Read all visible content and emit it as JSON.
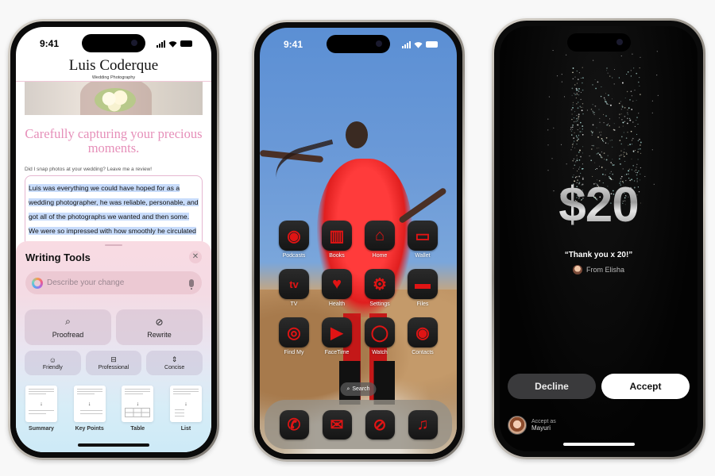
{
  "status_bar": {
    "time": "9:41"
  },
  "writing_phone": {
    "site_title": "Luis Coderque",
    "site_subtitle": "Wedding Photography",
    "tagline": "Carefully capturing your precious moments.",
    "review_prompt": "Did I snap photos at your wedding? Leave me a review!",
    "review_text": "Luis was everything we could have hoped for as a wedding photographer, he was reliable, personable, and got all of the photographs we wanted and then some. We were so impressed with how smoothly he circulated through our ceremony and reception. We barely realized he was there except when he was very",
    "writing_tools": {
      "title": "Writing Tools",
      "close_icon": "xmark",
      "input_placeholder": "Describe your change",
      "primary_actions": [
        {
          "label": "Proofread",
          "icon": "magnifier-text-icon"
        },
        {
          "label": "Rewrite",
          "icon": "rewrite-icon"
        }
      ],
      "tone_actions": [
        {
          "label": "Friendly",
          "icon": "smiley-icon"
        },
        {
          "label": "Professional",
          "icon": "briefcase-icon"
        },
        {
          "label": "Concise",
          "icon": "compress-icon"
        }
      ],
      "formats": [
        {
          "label": "Summary"
        },
        {
          "label": "Key Points"
        },
        {
          "label": "Table"
        },
        {
          "label": "List"
        }
      ]
    }
  },
  "home_phone": {
    "apps": [
      {
        "label": "Podcasts",
        "glyph": "◉"
      },
      {
        "label": "Books",
        "glyph": "▥"
      },
      {
        "label": "Home",
        "glyph": "⌂"
      },
      {
        "label": "Wallet",
        "glyph": "▭"
      },
      {
        "label": "TV",
        "glyph": "tv"
      },
      {
        "label": "Health",
        "glyph": "♥"
      },
      {
        "label": "Settings",
        "glyph": "⚙"
      },
      {
        "label": "Files",
        "glyph": "▬"
      },
      {
        "label": "Find My",
        "glyph": "◎"
      },
      {
        "label": "FaceTime",
        "glyph": "▶"
      },
      {
        "label": "Watch",
        "glyph": "◯"
      },
      {
        "label": "Contacts",
        "glyph": "◉"
      }
    ],
    "search_label": "Search",
    "dock": [
      {
        "label": "Phone",
        "glyph": "✆"
      },
      {
        "label": "Mail",
        "glyph": "✉"
      },
      {
        "label": "Safari",
        "glyph": "⊘"
      },
      {
        "label": "Music",
        "glyph": "♫"
      }
    ],
    "accent_color": "#e01414"
  },
  "cash_phone": {
    "amount": "$20",
    "memo": "“Thank you x 20!”",
    "from": "From Elisha",
    "decline_label": "Decline",
    "accept_label": "Accept",
    "accept_as_label": "Accept as",
    "accept_as_name": "Mayuri"
  }
}
